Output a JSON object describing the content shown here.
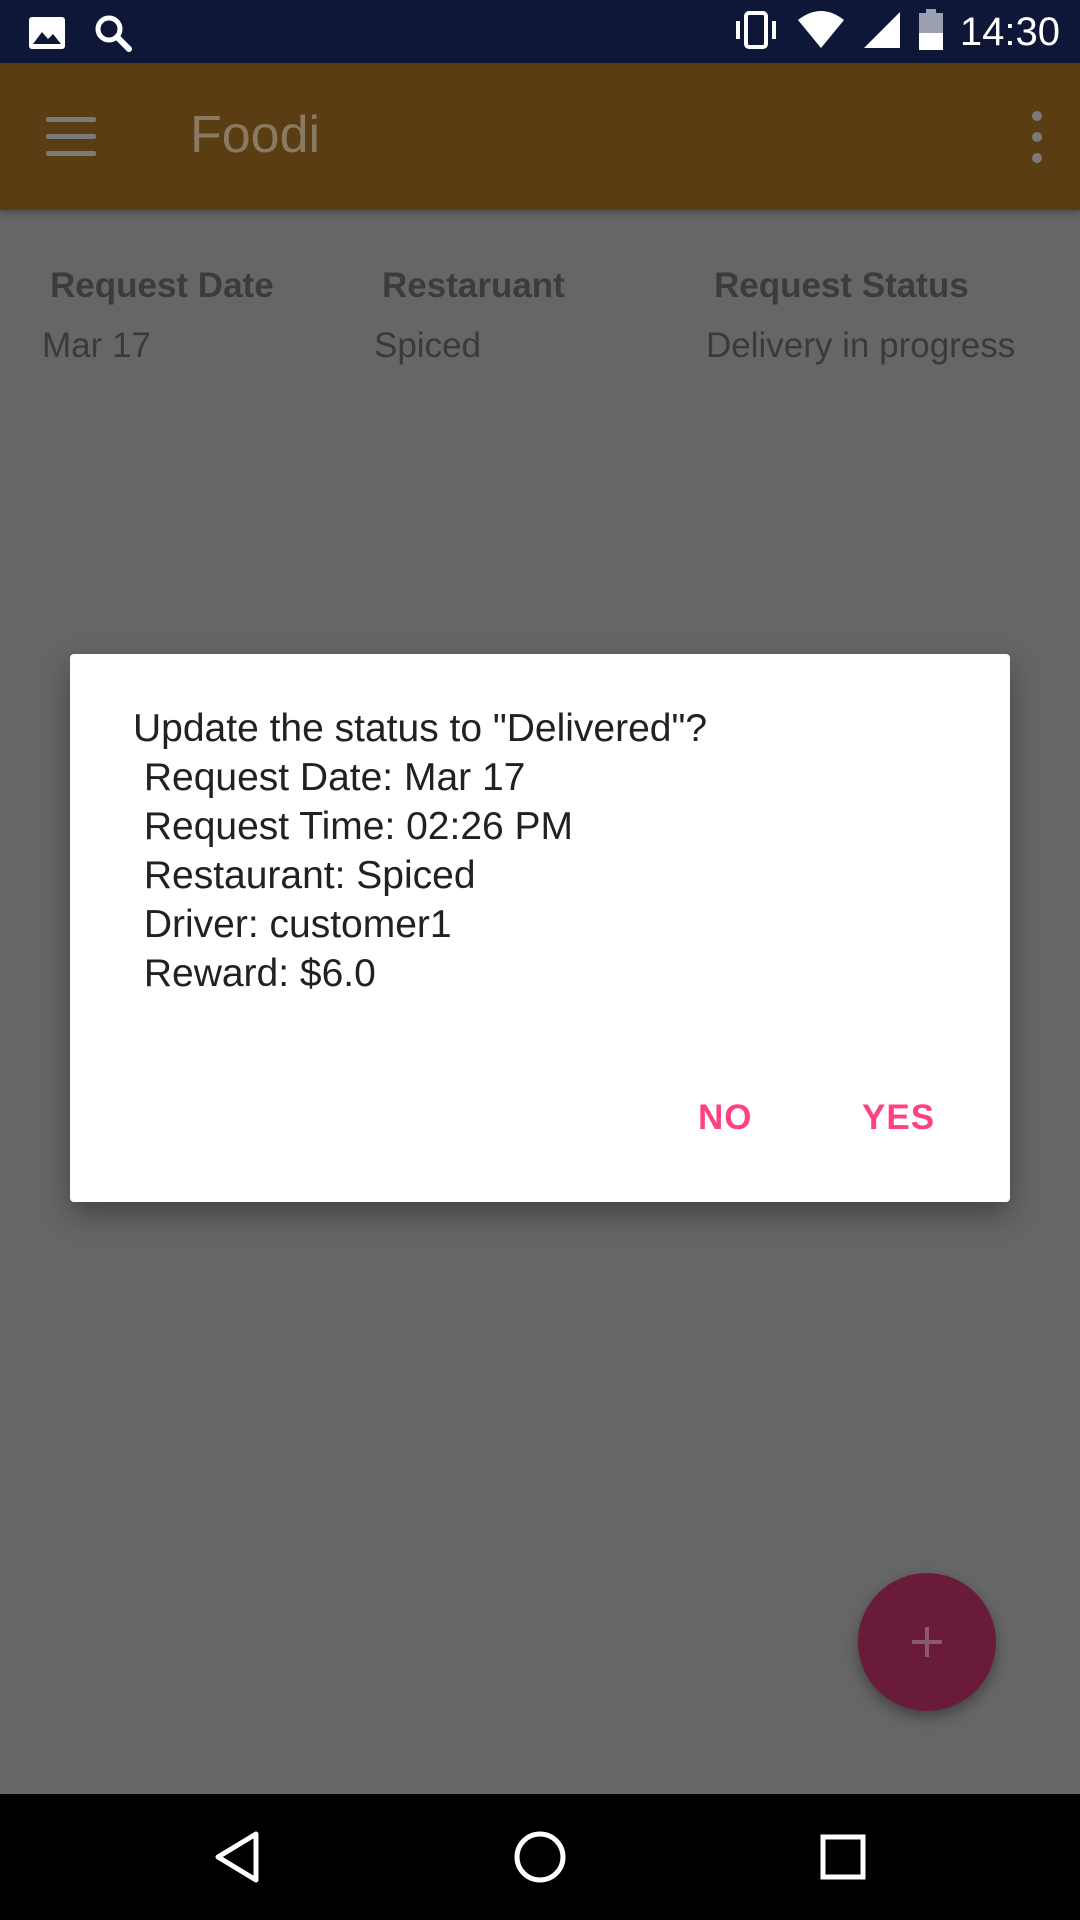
{
  "status_bar": {
    "time": "14:30",
    "left_icons": [
      "image-icon",
      "search-icon"
    ],
    "right_icons": [
      "vibrate-icon",
      "wifi-icon",
      "signal-icon",
      "battery-icon"
    ]
  },
  "app_bar": {
    "title": "Foodi",
    "menu_icon": "menu-icon",
    "overflow_icon": "more-vert-icon"
  },
  "table": {
    "headers": [
      "Request Date",
      "Restaruant",
      "Request Status"
    ],
    "rows": [
      [
        "Mar 17",
        "Spiced",
        "Delivery in progress"
      ]
    ]
  },
  "dialog": {
    "lines": [
      "Update the status to \"Delivered\"?",
      " Request Date: Mar 17",
      " Request Time: 02:26 PM",
      " Restaurant: Spiced",
      " Driver: customer1",
      " Reward: $6.0"
    ],
    "no_label": "NO",
    "yes_label": "YES"
  },
  "fab": {
    "icon": "add-icon"
  },
  "nav_bar": {
    "icons": [
      "back-icon",
      "home-icon",
      "recents-icon"
    ]
  },
  "colors": {
    "accent": "#ff4081",
    "scrim_background": "#666666",
    "app_bar": "#5a3d12",
    "status_bar": "#0f1738"
  }
}
